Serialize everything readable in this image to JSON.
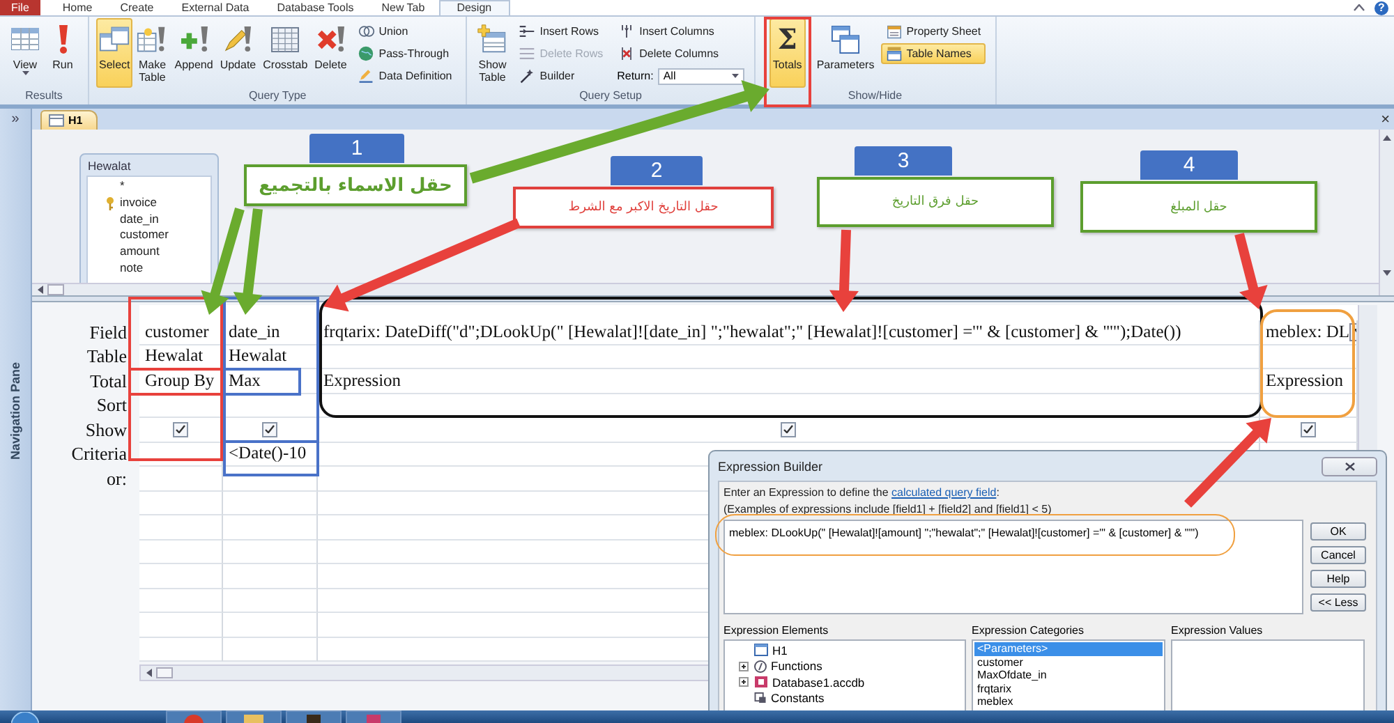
{
  "ribbon_tabs": [
    {
      "label": "File",
      "kind": "file",
      "selected": false
    },
    {
      "label": "Home",
      "kind": "tab",
      "selected": false
    },
    {
      "label": "Create",
      "kind": "tab",
      "selected": false
    },
    {
      "label": "External Data",
      "kind": "tab",
      "selected": false
    },
    {
      "label": "Database Tools",
      "kind": "tab",
      "selected": false
    },
    {
      "label": "New Tab",
      "kind": "tab",
      "selected": false
    },
    {
      "label": "Design",
      "kind": "tab",
      "selected": true
    }
  ],
  "help_button": "?",
  "ribbon_groups": [
    {
      "label": "Results",
      "items": [
        {
          "kind": "split",
          "label": "View",
          "selected": false,
          "disabled": false
        },
        {
          "kind": "large",
          "label": "Run",
          "selected": false,
          "disabled": false
        }
      ]
    },
    {
      "label": "Query Type",
      "items": [
        {
          "kind": "large",
          "label": "Select",
          "selected": true,
          "disabled": false
        },
        {
          "kind": "large",
          "label": "Make Table",
          "selected": false,
          "disabled": false
        },
        {
          "kind": "large",
          "label": "Append",
          "selected": false,
          "disabled": false
        },
        {
          "kind": "large",
          "label": "Update",
          "selected": false,
          "disabled": false
        },
        {
          "kind": "large",
          "label": "Crosstab",
          "selected": false,
          "disabled": false
        },
        {
          "kind": "large",
          "label": "Delete",
          "selected": false,
          "disabled": false
        },
        {
          "kind": "small",
          "label": "Union",
          "selected": false,
          "disabled": false
        },
        {
          "kind": "small",
          "label": "Pass-Through",
          "selected": false,
          "disabled": false
        },
        {
          "kind": "small",
          "label": "Data Definition",
          "selected": false,
          "disabled": false
        }
      ]
    },
    {
      "label": "Query Setup",
      "items": [
        {
          "kind": "large",
          "label": "Show Table",
          "selected": false,
          "disabled": false
        },
        {
          "kind": "small",
          "label": "Insert Rows",
          "selected": false,
          "disabled": false
        },
        {
          "kind": "small",
          "label": "Delete Rows",
          "selected": false,
          "disabled": true
        },
        {
          "kind": "small",
          "label": "Builder",
          "selected": false,
          "disabled": false
        },
        {
          "kind": "small",
          "label": "Insert Columns",
          "selected": false,
          "disabled": false
        },
        {
          "kind": "small",
          "label": "Delete Columns",
          "selected": false,
          "disabled": false
        },
        {
          "kind": "combo",
          "label": "Return:",
          "value": "All"
        }
      ]
    },
    {
      "label": "Show/Hide",
      "items": [
        {
          "kind": "large",
          "label": "Totals",
          "glyph": "Σ",
          "selected": true,
          "disabled": false
        },
        {
          "kind": "large",
          "label": "Parameters",
          "selected": false,
          "disabled": false
        },
        {
          "kind": "small",
          "label": "Property Sheet",
          "selected": false,
          "disabled": false
        },
        {
          "kind": "small",
          "label": "Table Names",
          "selected": true,
          "disabled": false
        }
      ]
    }
  ],
  "navigation_pane": {
    "toggle": "»",
    "title": "Navigation Pane"
  },
  "document": {
    "tab": "H1",
    "close": "×"
  },
  "field_list": {
    "title": "Hewalat",
    "fields": [
      {
        "name": "*",
        "key": false
      },
      {
        "name": "invoice",
        "key": true
      },
      {
        "name": "date_in",
        "key": false
      },
      {
        "name": "customer",
        "key": false
      },
      {
        "name": "amount",
        "key": false
      },
      {
        "name": "note",
        "key": false
      }
    ]
  },
  "design_grid": {
    "row_labels": [
      "Field",
      "Table",
      "Total",
      "Sort",
      "Show",
      "Criteria",
      "or:"
    ],
    "columns": [
      {
        "field": "customer",
        "table": "Hewalat",
        "total": "Group By",
        "show": true,
        "selected": false
      },
      {
        "field": "date_in",
        "table": "Hewalat",
        "total": "Max",
        "show": true,
        "criteria": "<Date()-10",
        "selected": false
      },
      {
        "field": "frqtarix: DateDiff(\"d\";DLookUp(\" [Hewalat]![date_in] \";\"hewalat\";\" [Hewalat]![customer] ='\" & [customer] & \"'\");Date())",
        "total": "Expression",
        "show": true,
        "selected": false
      },
      {
        "field": "meblex: DL",
        "total": "Expression",
        "show": true,
        "selected": true
      }
    ]
  },
  "annotations": {
    "markers": [
      "1",
      "2",
      "3",
      "4"
    ],
    "callouts": [
      {
        "text": "حقل الاسماء بالتجميع",
        "color": "#5c9e2e"
      },
      {
        "text": "حقل التاريخ الاكبر مع الشرط",
        "color": "#e0403c"
      },
      {
        "text": "حقل فرق التاريخ",
        "color": "#5c9e2e"
      },
      {
        "text": "حقل المبلغ",
        "color": "#5c9e2e"
      }
    ]
  },
  "expression_builder": {
    "title": "Expression Builder",
    "prompt": "Enter an Expression to define the ",
    "link": "calculated query field",
    "prompt_end": ":",
    "examples": "(Examples of expressions include [field1] + [field2] and [field1] < 5)",
    "expression": "meblex: DLookUp(\" [Hewalat]![amount] \";\"hewalat\";\" [Hewalat]![customer] ='\" & [customer] & \"'\")",
    "buttons": [
      "OK",
      "Cancel",
      "Help",
      "<< Less"
    ],
    "elements_label": "Expression Elements",
    "elements": [
      {
        "name": "H1",
        "kind": "leaf"
      },
      {
        "name": "Functions",
        "kind": "collapsed"
      },
      {
        "name": "Database1.accdb",
        "kind": "collapsed"
      },
      {
        "name": "Constants",
        "kind": "leaf"
      }
    ],
    "categories_label": "Expression Categories",
    "categories": [
      {
        "name": "<Parameters>",
        "selected": true
      },
      {
        "name": "customer",
        "selected": false
      },
      {
        "name": "MaxOfdate_in",
        "selected": false
      },
      {
        "name": "frqtarix",
        "selected": false
      },
      {
        "name": "meblex",
        "selected": false
      }
    ],
    "values_label": "Expression Values"
  }
}
